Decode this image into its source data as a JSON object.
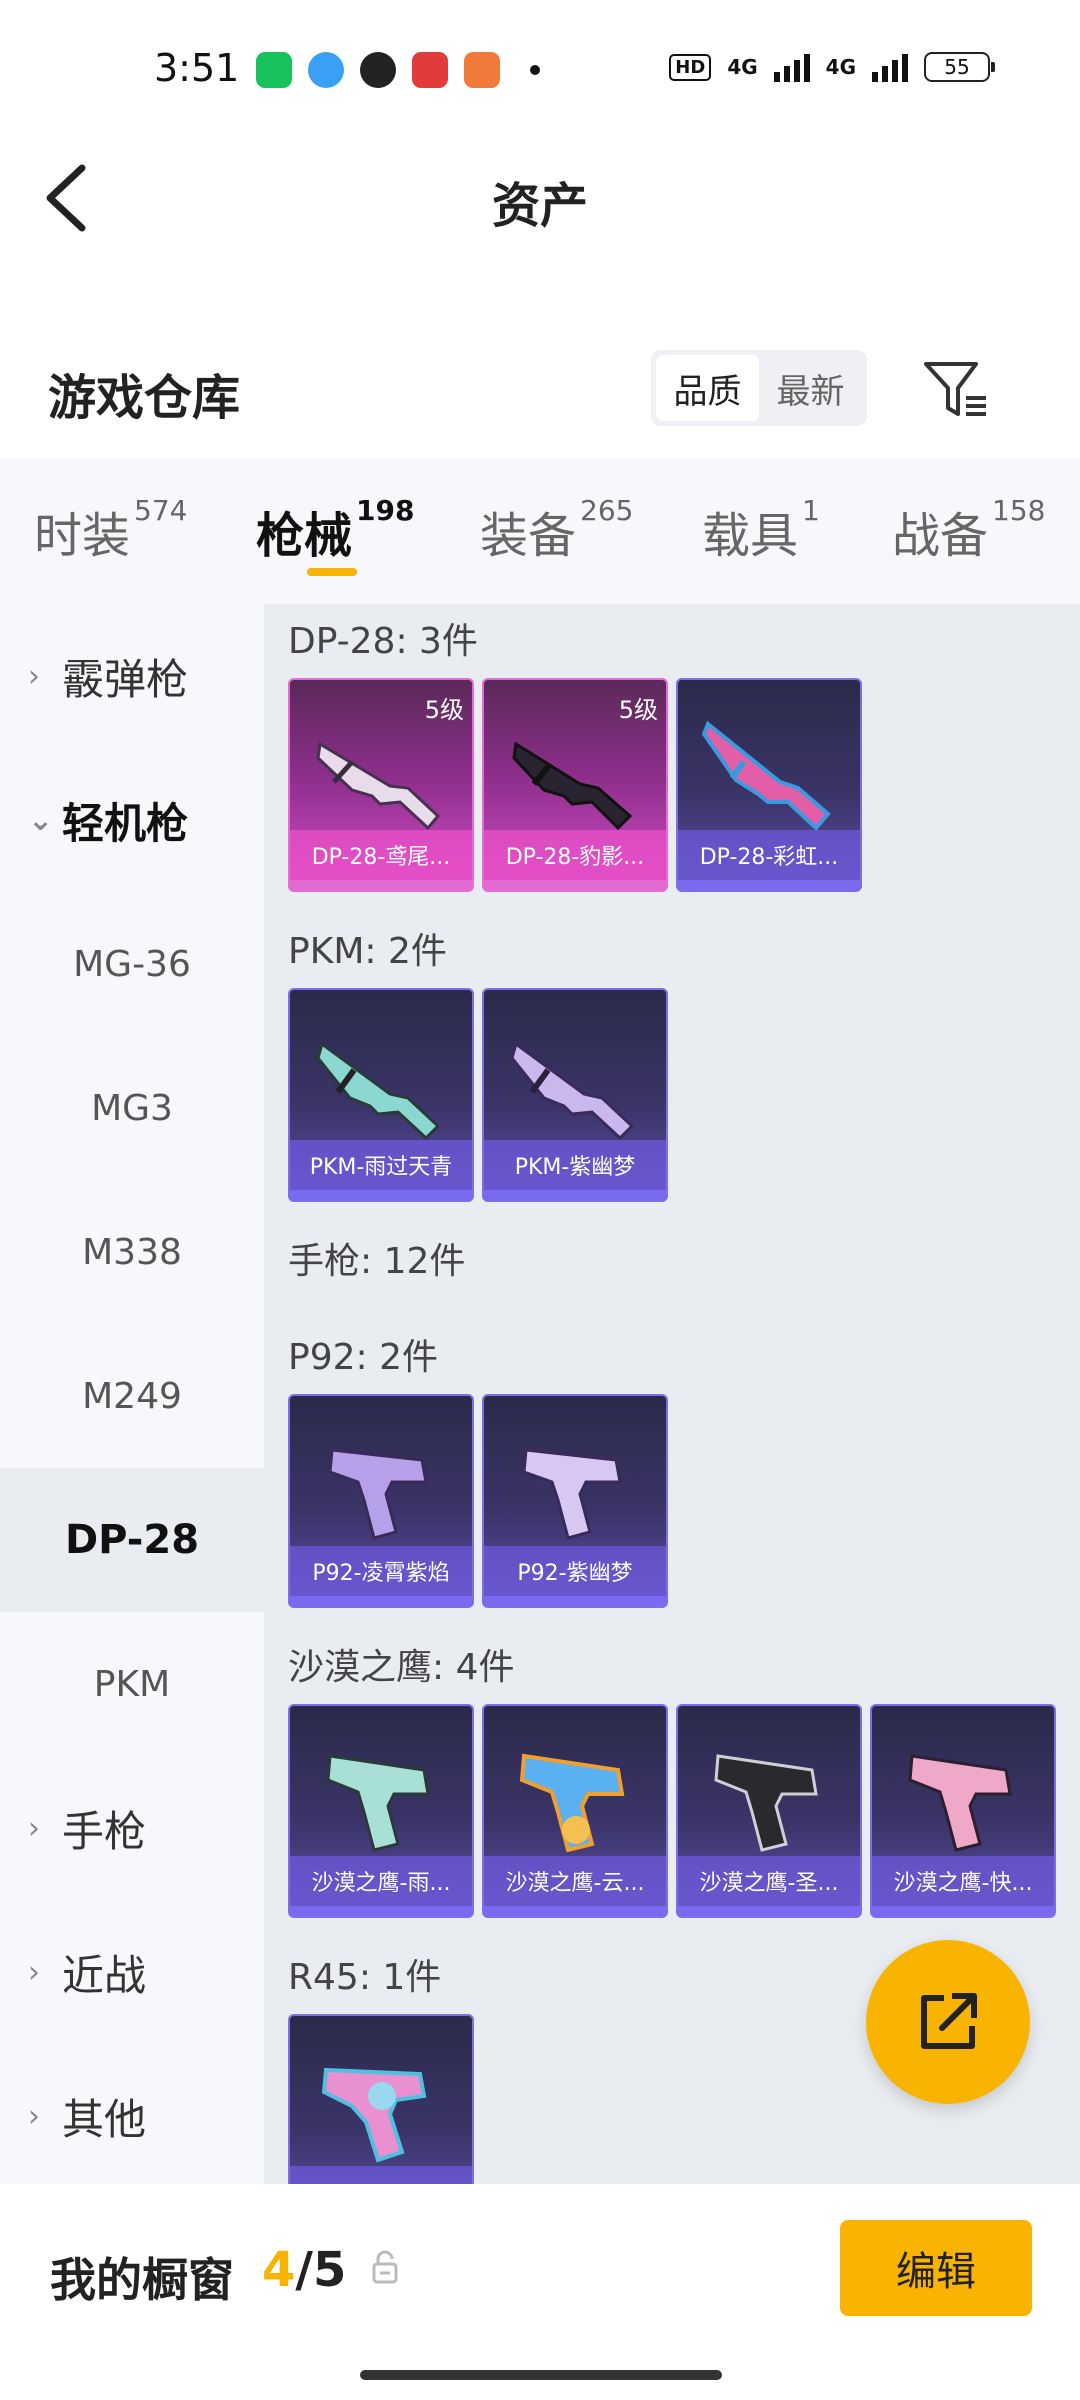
{
  "status": {
    "time": "3:51",
    "hd": "HD",
    "net1": "4G",
    "net2": "4G",
    "battery": "55",
    "app_colors": [
      "#18c25b",
      "#3aa0f5",
      "#222222",
      "#e23b3b",
      "#f07a3a"
    ]
  },
  "header": {
    "title": "资产",
    "back_icon": "chevron-left-icon"
  },
  "warehouse": {
    "title": "游戏仓库",
    "sort": {
      "options": [
        "品质",
        "最新"
      ],
      "selected": "品质"
    },
    "filter_icon": "filter-icon"
  },
  "tabs": [
    {
      "label": "时装",
      "count": "574"
    },
    {
      "label": "枪械",
      "count": "198",
      "active": true
    },
    {
      "label": "装备",
      "count": "265"
    },
    {
      "label": "载具",
      "count": "1"
    },
    {
      "label": "战备",
      "count": "158"
    }
  ],
  "sidebar": {
    "items": [
      {
        "label": "霰弹枪",
        "type": "group",
        "expanded": false
      },
      {
        "label": "轻机枪",
        "type": "group",
        "expanded": true
      },
      {
        "label": "MG-36",
        "type": "sub"
      },
      {
        "label": "MG3",
        "type": "sub"
      },
      {
        "label": "M338",
        "type": "sub"
      },
      {
        "label": "M249",
        "type": "sub"
      },
      {
        "label": "DP-28",
        "type": "sub",
        "active": true
      },
      {
        "label": "PKM",
        "type": "sub"
      },
      {
        "label": "手枪",
        "type": "group",
        "expanded": false
      },
      {
        "label": "近战",
        "type": "group",
        "expanded": false
      },
      {
        "label": "其他",
        "type": "group",
        "expanded": false
      }
    ]
  },
  "sections": [
    {
      "label": "DP-28: 3件",
      "items": [
        {
          "name": "DP-28-鸢尾...",
          "level": "5级",
          "rarity": "purple"
        },
        {
          "name": "DP-28-豹影...",
          "level": "5级",
          "rarity": "purple"
        },
        {
          "name": "DP-28-彩虹...",
          "level": "",
          "rarity": "blue"
        }
      ]
    },
    {
      "label": "PKM: 2件",
      "items": [
        {
          "name": "PKM-雨过天青",
          "level": "",
          "rarity": "blue"
        },
        {
          "name": "PKM-紫幽梦",
          "level": "",
          "rarity": "blue"
        }
      ]
    },
    {
      "label": "手枪: 12件",
      "items": []
    },
    {
      "label": "P92: 2件",
      "items": [
        {
          "name": "P92-凌霄紫焰",
          "level": "",
          "rarity": "blue"
        },
        {
          "name": "P92-紫幽梦",
          "level": "",
          "rarity": "blue"
        }
      ]
    },
    {
      "label": "沙漠之鹰: 4件",
      "items": [
        {
          "name": "沙漠之鹰-雨...",
          "level": "",
          "rarity": "blue"
        },
        {
          "name": "沙漠之鹰-云...",
          "level": "",
          "rarity": "blue"
        },
        {
          "name": "沙漠之鹰-圣...",
          "level": "",
          "rarity": "blue"
        },
        {
          "name": "沙漠之鹰-快...",
          "level": "",
          "rarity": "blue"
        }
      ]
    },
    {
      "label": "R45: 1件",
      "items": [
        {
          "name": "",
          "level": "",
          "rarity": "blue"
        }
      ]
    }
  ],
  "fab": {
    "icon": "share-icon"
  },
  "showcase": {
    "label": "我的橱窗",
    "current": "4",
    "separator": "/",
    "total": "5",
    "lock_icon": "lock-icon",
    "edit_label": "编辑"
  },
  "colors": {
    "accent": "#f8b400",
    "purple_rarity": "#d44dca",
    "blue_rarity": "#5a50a8"
  }
}
